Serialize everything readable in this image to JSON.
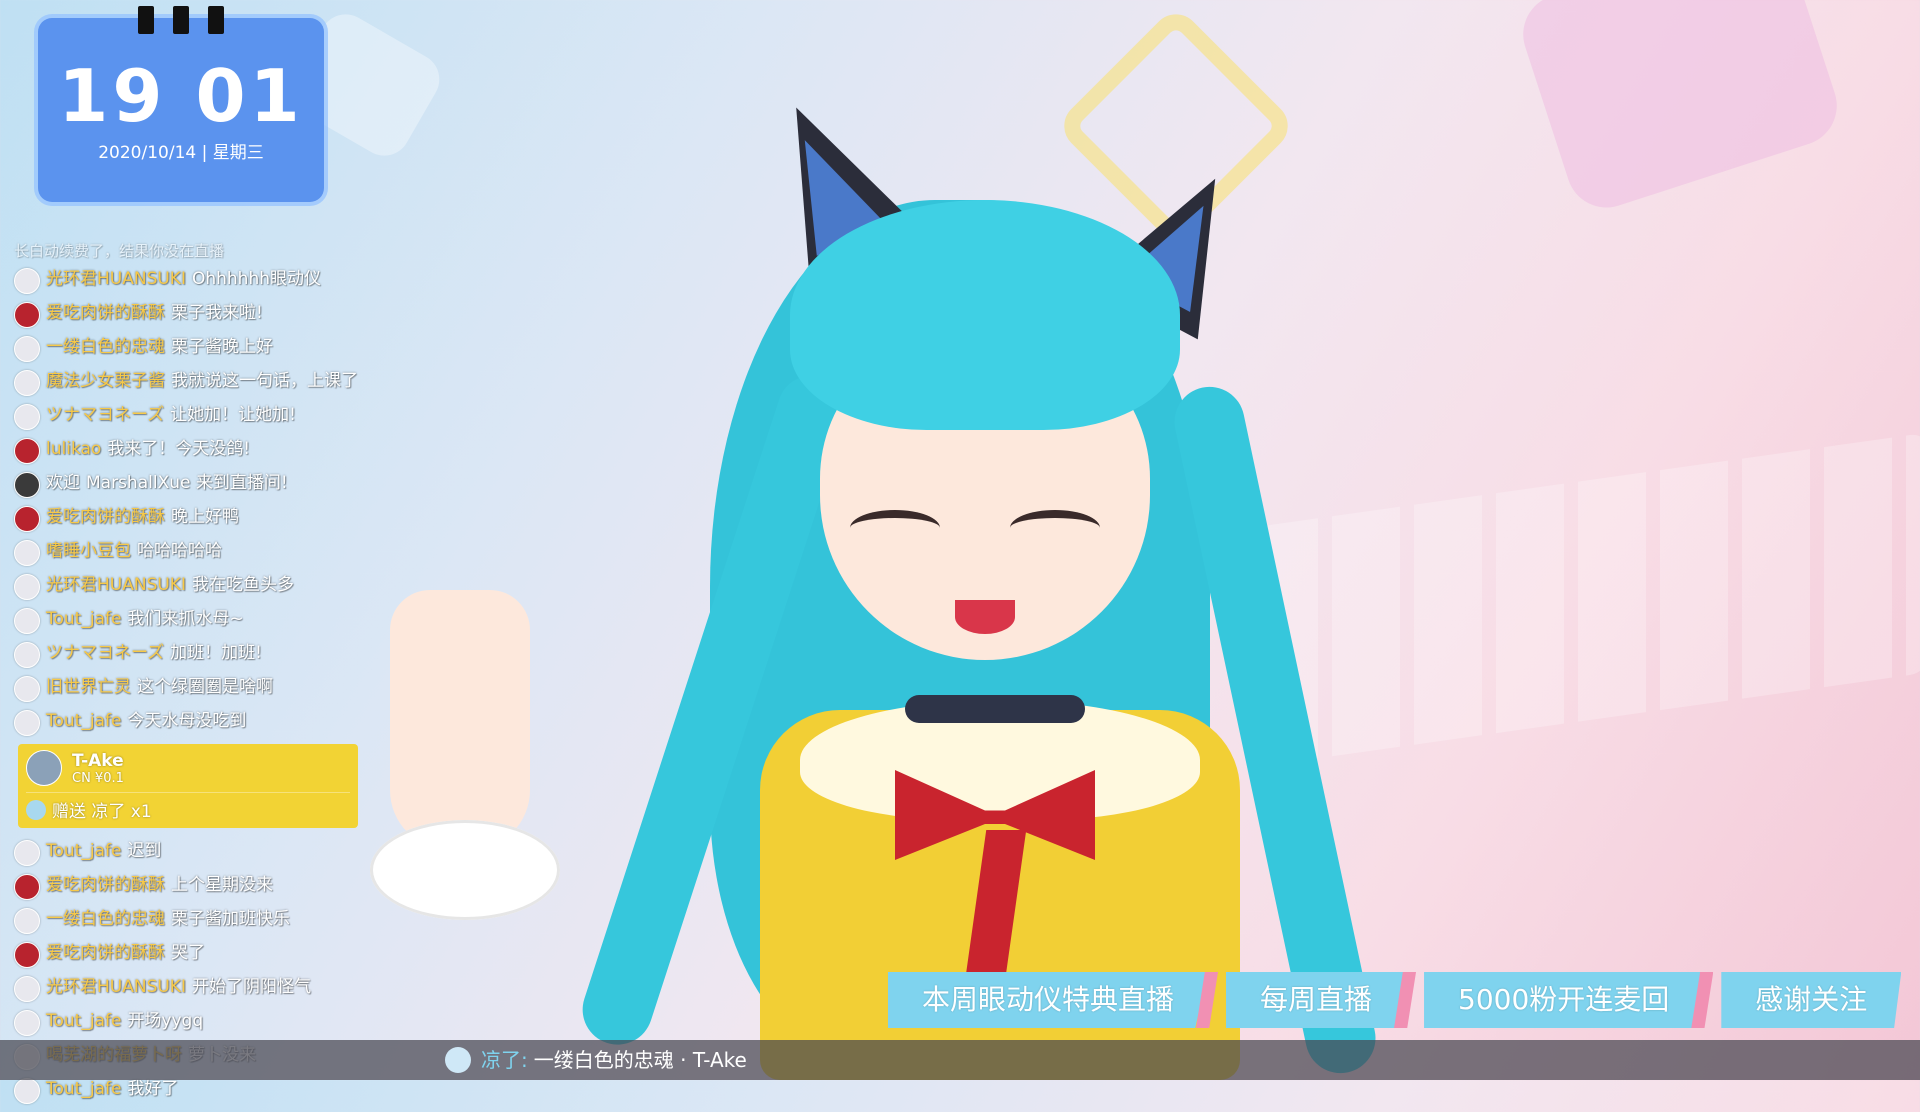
{
  "clock": {
    "time": "19 01",
    "date": "2020/10/14 | 星期三"
  },
  "chat": {
    "partial_top": "长白动续费了，结果你没在直播",
    "messages": [
      {
        "user": "光环君HUANSUKI",
        "text": "Ohhhhhh眼动仪",
        "avatar": "avatar-light"
      },
      {
        "user": "爱吃肉饼的酥酥",
        "text": "栗子我来啦!",
        "avatar": "avatar-red"
      },
      {
        "user": "一缕白色的忠魂",
        "text": "栗子酱晚上好",
        "avatar": "avatar-light"
      },
      {
        "user": "魔法少女栗子酱",
        "text": "我就说这一句话，上课了",
        "avatar": "avatar-light"
      },
      {
        "user": "ツナマヨネーズ",
        "text": "让她加！让她加!",
        "avatar": "avatar-light"
      },
      {
        "user": "lulikao",
        "text": "我来了！今天没鸽!",
        "avatar": "avatar-red"
      },
      {
        "user": "欢迎",
        "text": "MarshallXue 来到直播间!",
        "avatar": "avatar-dark"
      },
      {
        "user": "爱吃肉饼的酥酥",
        "text": "晚上好鸭",
        "avatar": "avatar-red"
      },
      {
        "user": "嗜睡小豆包",
        "text": "哈哈哈哈哈",
        "avatar": "avatar-light"
      },
      {
        "user": "光环君HUANSUKI",
        "text": "我在吃鱼头多",
        "avatar": "avatar-light"
      },
      {
        "user": "Tout_jafe",
        "text": "我们来抓水母~",
        "avatar": "avatar-light"
      },
      {
        "user": "ツナマヨネーズ",
        "text": "加班！加班!",
        "avatar": "avatar-light"
      },
      {
        "user": "旧世界亡灵",
        "text": "这个绿圈圈是啥啊",
        "avatar": "avatar-light"
      },
      {
        "user": "Tout_jafe",
        "text": "今天水母没吃到",
        "avatar": "avatar-light"
      }
    ],
    "gift": {
      "name": "T-Ake",
      "amount": "CN ¥0.1",
      "text": "赠送 凉了 x1"
    },
    "messages_after": [
      {
        "user": "Tout_jafe",
        "text": "迟到",
        "avatar": "avatar-light"
      },
      {
        "user": "爱吃肉饼的酥酥",
        "text": "上个星期没来",
        "avatar": "avatar-red"
      },
      {
        "user": "一缕白色的忠魂",
        "text": "栗子酱加班快乐",
        "avatar": "avatar-light"
      },
      {
        "user": "爱吃肉饼的酥酥",
        "text": "哭了",
        "avatar": "avatar-red"
      },
      {
        "user": "光环君HUANSUKI",
        "text": "开始了阴阳怪气",
        "avatar": "avatar-light"
      },
      {
        "user": "Tout_jafe",
        "text": "开场yygq",
        "avatar": "avatar-light"
      },
      {
        "user": "喝芜湖的福萝卜呀",
        "text": "萝卜没来",
        "avatar": "avatar-light"
      },
      {
        "user": "Tout_jafe",
        "text": "我好了",
        "avatar": "avatar-light"
      }
    ]
  },
  "banner": {
    "items": [
      "本周眼动仪特典直播",
      "每周直播",
      "5000粉开连麦回",
      "感谢关注"
    ],
    "bg_color": "#7fd3ee",
    "sep_color": "#f190b3"
  },
  "ticker": {
    "gift_label": "凉了:",
    "text": "一缕白色的忠魂 · T-Ake"
  },
  "colors": {
    "clock_bg": "#5b93ee",
    "gift_bg": "#f2d334",
    "username": "#f7c948"
  }
}
